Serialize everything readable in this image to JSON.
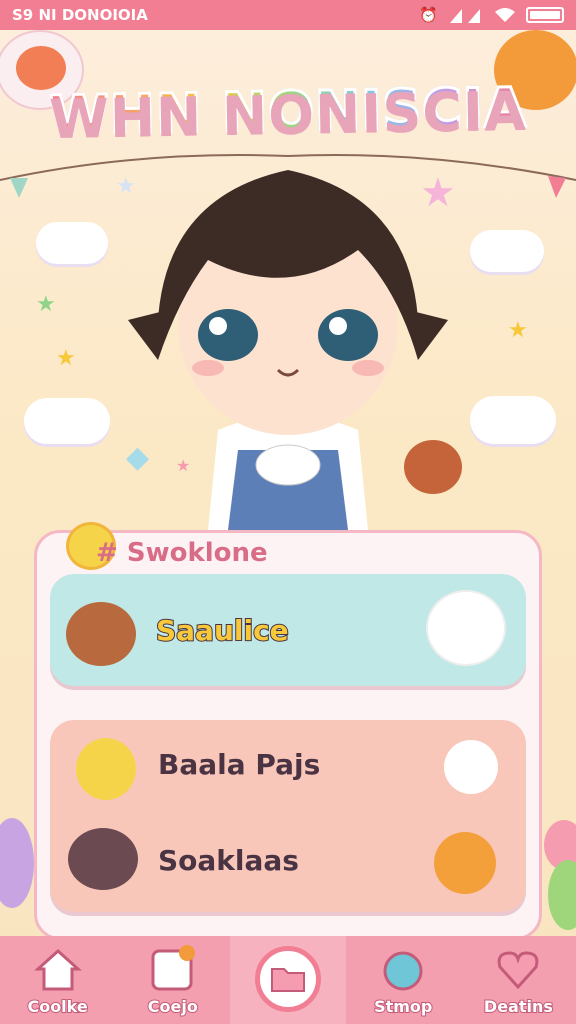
{
  "status": {
    "left": "S9 NI DONOIOIA"
  },
  "app": {
    "title": "WHN NONISCIA"
  },
  "panel": {
    "title": "Swoklone"
  },
  "cards": [
    {
      "label": "Saaulice",
      "icon": "bear-face-icon",
      "right_icon": "white-bear-icon"
    },
    {
      "label": "Baala Pajs",
      "icon": "yellow-chick-icon",
      "right_icon": "white-bunny-icon"
    },
    {
      "label": "Soaklaas",
      "icon": "cat-face-icon",
      "right_icon": "orange-sprout-icon"
    }
  ],
  "nav": [
    {
      "label": "Coolke",
      "icon": "home-icon"
    },
    {
      "label": "Coejo",
      "icon": "calendar-icon"
    },
    {
      "label": "",
      "icon": "folder-icon"
    },
    {
      "label": "Stmop",
      "icon": "drop-icon"
    },
    {
      "label": "Deatins",
      "icon": "heart-icon"
    }
  ],
  "colors": {
    "accent": "#f27e93",
    "card_mint": "#bfe8e6",
    "card_peach": "#f9c7b9"
  }
}
